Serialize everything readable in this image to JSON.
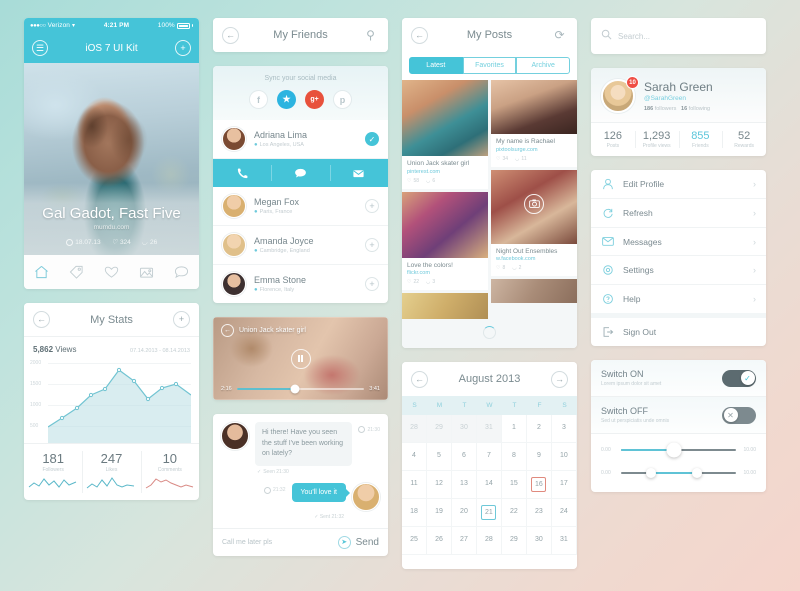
{
  "phone1": {
    "status": {
      "carrier": "Verizon",
      "time": "4:21 PM",
      "battery": "100%",
      "signal": "●●●○○",
      "wifi": "▼"
    },
    "nav": {
      "title": "iOS 7 UI Kit",
      "menu_icon": "list-icon",
      "add_icon": "plus-icon"
    },
    "hero": {
      "title": "Gal Gadot, Fast Five",
      "source": "mumdu.com",
      "date": "18.07.13",
      "likes": "324",
      "comments": "26"
    },
    "tabbar": [
      "home-icon",
      "tag-icon",
      "heart-icon",
      "gallery-icon",
      "comment-icon"
    ]
  },
  "stats": {
    "nav": {
      "title": "My Stats",
      "back_icon": "back-arrow-icon",
      "add_icon": "plus-icon"
    },
    "views_value": "5,862",
    "views_label": "Views",
    "date_range": "07.14.2013 - 08.14.2013",
    "cells": [
      {
        "number": "181",
        "label": "Followers"
      },
      {
        "number": "247",
        "label": "Likes"
      },
      {
        "number": "10",
        "label": "Comments"
      }
    ]
  },
  "chart_data": [
    {
      "type": "line",
      "title": "My Stats",
      "subtitle": "5,862 Views",
      "xlabel": "",
      "ylabel": "",
      "ylim": [
        0,
        2200
      ],
      "yticks": [
        500,
        1000,
        1500,
        2000
      ],
      "grid": true,
      "legend": "none",
      "x": [
        0,
        1,
        2,
        3,
        4,
        5,
        6,
        7,
        8,
        9,
        10
      ],
      "values": [
        420,
        640,
        880,
        1180,
        1320,
        1780,
        1520,
        1090,
        1350,
        1450,
        1180
      ],
      "area_fill": true,
      "color": "#7ec9d4"
    },
    {
      "type": "line",
      "title": "Followers",
      "values": [
        4,
        7,
        5,
        9,
        6,
        8,
        5,
        9,
        6,
        8
      ],
      "color": "#5bb8c9"
    },
    {
      "type": "line",
      "title": "Likes",
      "values": [
        3,
        6,
        4,
        8,
        5,
        10,
        6,
        5,
        6,
        5
      ],
      "color": "#5bb8c9"
    },
    {
      "type": "line",
      "title": "Comments",
      "values": [
        3,
        5,
        9,
        7,
        8,
        6,
        5,
        4,
        5,
        4
      ],
      "color": "#d98a85"
    }
  ],
  "friends": {
    "nav": {
      "title": "My Friends",
      "back_icon": "back-arrow-icon",
      "search_icon": "search-icon"
    },
    "sync_title": "Sync your social media",
    "socials": [
      {
        "name": "facebook-icon",
        "glyph": "f"
      },
      {
        "name": "twitter-icon",
        "glyph": "t"
      },
      {
        "name": "googleplus-icon",
        "glyph": "g+"
      },
      {
        "name": "pinterest-icon",
        "glyph": "p"
      }
    ],
    "list": [
      {
        "name": "Adriana Lima",
        "location": "Los Angeles, USA",
        "state": "selected"
      },
      {
        "name": "Megan Fox",
        "location": "Paris, France",
        "state": "add"
      },
      {
        "name": "Amanda Joyce",
        "location": "Cambridge, England",
        "state": "add"
      },
      {
        "name": "Emma Stone",
        "location": "Florence, Italy",
        "state": "add"
      }
    ],
    "actions": [
      "call-icon",
      "chat-icon",
      "mail-icon"
    ]
  },
  "video": {
    "title": "Union Jack skater girl",
    "back_icon": "back-circle-icon",
    "play_icon": "pause-icon",
    "current_time": "2:16",
    "duration": "3:41",
    "progress_percent": 46
  },
  "chat": {
    "incoming": {
      "text": "Hi there! Have you seen the stuff I've been working on lately?",
      "time": "21:30",
      "receipt": "Seen 21:30"
    },
    "outgoing": {
      "text": "You'll love it",
      "time": "21:32",
      "receipt": "Sent 21:32"
    },
    "input_value": "Call me later pls",
    "send_label": "Send",
    "send_icon": "send-icon"
  },
  "posts": {
    "nav": {
      "title": "My Posts",
      "back_icon": "back-arrow-icon",
      "refresh_icon": "refresh-icon"
    },
    "tabs": [
      {
        "label": "Latest",
        "active": true
      },
      {
        "label": "Favorites",
        "active": false
      },
      {
        "label": "Archive",
        "active": false
      }
    ],
    "items": [
      {
        "title": "My name is Rachael",
        "link": "pixtoolsurge.com",
        "likes": "34",
        "comments": "11"
      },
      {
        "title": "Union Jack skater girl",
        "link": "pinterest.com",
        "likes": "58",
        "comments": "6"
      },
      {
        "title": "Love the colors!",
        "link": "flickr.com",
        "likes": "22",
        "comments": "3"
      },
      {
        "title": "Night Out Ensembles",
        "link": "w.facebook.com",
        "likes": "8",
        "comments": "2"
      }
    ],
    "loader": "loading-spinner"
  },
  "calendar": {
    "nav": {
      "title": "August 2013",
      "prev_icon": "back-arrow-icon",
      "next_icon": "forward-arrow-icon"
    },
    "weekdays": [
      "S",
      "M",
      "T",
      "W",
      "T",
      "F",
      "S"
    ],
    "days": [
      {
        "d": "28",
        "mute": true
      },
      {
        "d": "29",
        "mute": true
      },
      {
        "d": "30",
        "mute": true
      },
      {
        "d": "31",
        "mute": true
      },
      {
        "d": "1"
      },
      {
        "d": "2"
      },
      {
        "d": "3"
      },
      {
        "d": "4"
      },
      {
        "d": "5"
      },
      {
        "d": "6"
      },
      {
        "d": "7"
      },
      {
        "d": "8"
      },
      {
        "d": "9"
      },
      {
        "d": "10"
      },
      {
        "d": "11"
      },
      {
        "d": "12"
      },
      {
        "d": "13"
      },
      {
        "d": "14"
      },
      {
        "d": "15"
      },
      {
        "d": "16",
        "mark": "red"
      },
      {
        "d": "17"
      },
      {
        "d": "18"
      },
      {
        "d": "19"
      },
      {
        "d": "20"
      },
      {
        "d": "21",
        "mark": "teal"
      },
      {
        "d": "22"
      },
      {
        "d": "23"
      },
      {
        "d": "24"
      },
      {
        "d": "25"
      },
      {
        "d": "26"
      },
      {
        "d": "27"
      },
      {
        "d": "28"
      },
      {
        "d": "29"
      },
      {
        "d": "30"
      },
      {
        "d": "31"
      }
    ]
  },
  "search": {
    "placeholder": "Search...",
    "icon": "search-icon"
  },
  "profile": {
    "name": "Sarah Green",
    "handle": "@SarahGreen",
    "badge_count": "10",
    "followers_count": "186",
    "followers_label": "followers",
    "following_count": "16",
    "following_label": "following",
    "cells": [
      {
        "number": "126",
        "label": "Posts",
        "highlight": false
      },
      {
        "number": "1,293",
        "label": "Profile views",
        "highlight": false
      },
      {
        "number": "855",
        "label": "Friends",
        "highlight": true
      },
      {
        "number": "52",
        "label": "Rewards",
        "highlight": false
      }
    ]
  },
  "menu": {
    "items": [
      {
        "label": "Edit Profile",
        "icon": "user-icon",
        "chevron": true
      },
      {
        "label": "Refresh",
        "icon": "refresh-icon",
        "chevron": true
      },
      {
        "label": "Messages",
        "icon": "envelope-icon",
        "chevron": true
      },
      {
        "label": "Settings",
        "icon": "gear-icon",
        "chevron": true
      },
      {
        "label": "Help",
        "icon": "help-icon",
        "chevron": true
      }
    ],
    "signout": {
      "label": "Sign Out",
      "icon": "signout-icon"
    }
  },
  "switches": {
    "on": {
      "title": "Switch ON",
      "subtitle": "Lorem ipsum dolor sit amet",
      "state": "on",
      "icon": "check-icon"
    },
    "off": {
      "title": "Switch OFF",
      "subtitle": "Sed ut perspiciatis unde omnis",
      "state": "off",
      "icon": "close-icon"
    },
    "slider_single": {
      "min_label": "0.00",
      "max_label": "10.00",
      "value_percent": 46
    },
    "slider_range": {
      "min_label": "0.00",
      "max_label": "10.00",
      "low_percent": 26,
      "high_percent": 66
    }
  }
}
